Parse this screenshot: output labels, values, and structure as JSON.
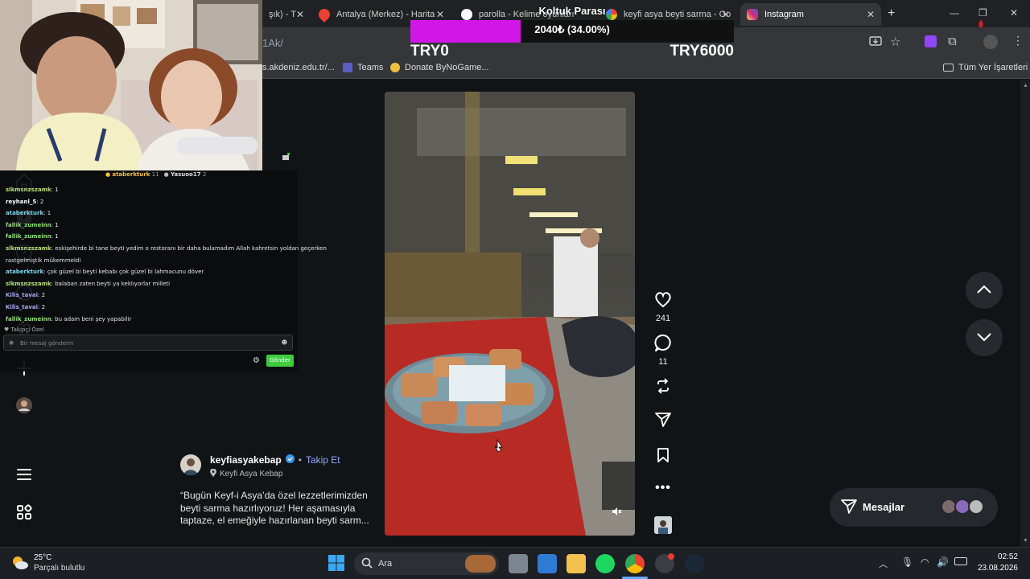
{
  "tabs": [
    {
      "label": "şık) - T",
      "fav": "#888"
    },
    {
      "label": "Antalya (Merkez) - Harita",
      "fav": "#e94235"
    },
    {
      "label": "parolla - Kelime oyunları",
      "fav": "#ffffff"
    },
    {
      "label": "keyfi asya beyti sarma - Go",
      "fav": "#4285f4"
    },
    {
      "label": "Instagram",
      "fav": "#d62976"
    }
  ],
  "address": {
    "url": "1Ak/"
  },
  "bookmarks": {
    "b1": "s.akdeniz.edu.tr/...",
    "b2": "Teams",
    "b3": "Donate ByNoGame...",
    "all": "Tüm Yer İşaretleri"
  },
  "donation": {
    "title": "Koltuk Parası",
    "amount": "2040₺ (34.00%)",
    "progress": 0.34,
    "min": "TRY0",
    "max": "TRY6000",
    "bar_color": "#d216e8"
  },
  "chat": {
    "header_user1": "ataberkturk",
    "header_user1_count": "11",
    "header_user2": "Yasuoo17",
    "header_user2_count": "2",
    "lines": [
      {
        "name": "slkmsnzszamk",
        "text": ": 1",
        "color": "#b7e07a"
      },
      {
        "name": "reyhanl_5",
        "text": ": 2",
        "color": "#ffffff"
      },
      {
        "name": "ataberkturk",
        "text": ": 1",
        "color": "#7ad8f0"
      },
      {
        "name": "fallik_zumeinn",
        "text": ": 1",
        "color": "#8fe07a"
      },
      {
        "name": "fallik_zumeinn",
        "text": ": 1",
        "color": "#8fe07a"
      },
      {
        "name": "slkmsnzszamk",
        "text": ": eskişehirde bi tane beyti yedim o restoranı bir daha bulamadım Allah kahretsin yoldan geçerken",
        "color": "#b7e07a"
      },
      {
        "name": "",
        "text": "rastgelmiştik mükemmeldi",
        "color": "#ffffff"
      },
      {
        "name": "ataberkturk",
        "text": ": çok güzel bi beyti kebabı çok güzel bi lahmacunu döver",
        "color": "#7ad8f0"
      },
      {
        "name": "slkmsnzszamk",
        "text": ": balaban zaten beyti ya keklıyorlar milleti",
        "color": "#b7e07a"
      },
      {
        "name": "Kilis_tavai",
        "text": ": 2",
        "color": "#a9a9ff"
      },
      {
        "name": "Kilis_tavai",
        "text": ": 2",
        "color": "#a9a9ff"
      },
      {
        "name": "fallik_zumeinn",
        "text": ": bu adam beni şey yapabilir",
        "color": "#8fe07a"
      }
    ],
    "mode": "Takipçi Özel",
    "placeholder": "Bir mesaj gönderin",
    "send": "Gönder"
  },
  "post": {
    "username": "keyfiasyakebap",
    "follow": "Takip Et",
    "location": "Keyfi Asya Kebap",
    "caption_line1": "“Bugün Keyf-i Asya’da özel lezzetlerimizden",
    "caption_line2": "beyti sarma hazırlıyoruz! Her aşamasıyla",
    "caption_line3": "taptaze, el emeğiyle hazırlanan beyti sarm...",
    "likes": "241",
    "comments": "11"
  },
  "messages": {
    "label": "Mesajlar"
  },
  "taskbar": {
    "temp": "25°C",
    "weather": "Parçalı bulutlu",
    "search": "Ara",
    "time": "02:52",
    "date": "23.08.2026"
  }
}
